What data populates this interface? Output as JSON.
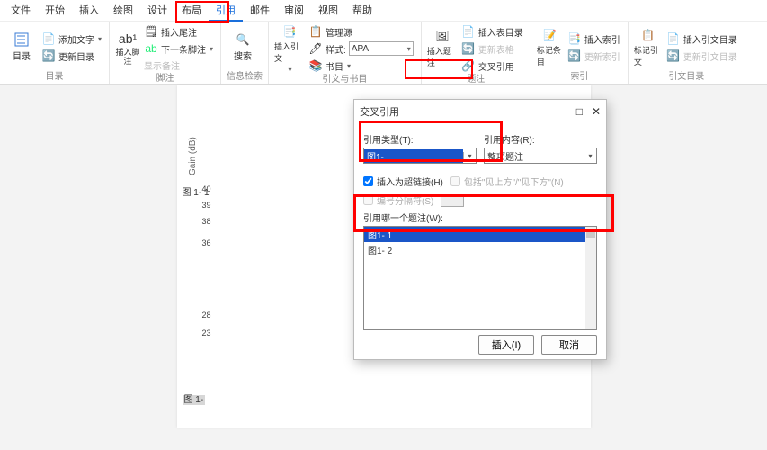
{
  "menu": {
    "items": [
      "文件",
      "开始",
      "插入",
      "绘图",
      "设计",
      "布局",
      "引用",
      "邮件",
      "审阅",
      "视图",
      "帮助"
    ],
    "active": 6
  },
  "ribbon": {
    "toc": {
      "big": "目录",
      "addText": "添加文字",
      "update": "更新目录",
      "label": "目录"
    },
    "footnote": {
      "big": "插入脚注",
      "next": "下一条脚注",
      "show": "显示备注",
      "label": "脚注"
    },
    "search": {
      "big": "搜索",
      "label": "信息检索"
    },
    "citation": {
      "big": "插入引文",
      "manage": "管理源",
      "styleLbl": "样式:",
      "styleVal": "APA",
      "bib": "书目",
      "label": "引文与书目"
    },
    "caption": {
      "big": "插入题注",
      "insTbl": "插入表目录",
      "cross": "交叉引用",
      "label": "题注"
    },
    "mark": {
      "big": "标记条目",
      "insIdx": "插入索引",
      "updIdx": "更新索引",
      "label": "索引"
    },
    "cite2": {
      "big": "标记引文",
      "insCit": "插入引文目录",
      "updCit": "更新引文目录",
      "label": "引文目录"
    }
  },
  "doc": {
    "axis": "Gain (dB)",
    "yticks": [
      "40",
      "39",
      "38",
      "36",
      "28",
      "23"
    ],
    "cap1pre": "图 1- 1",
    "cap2pre": "图 1-"
  },
  "dialog": {
    "title": "交叉引用",
    "typeLbl": "引用类型(T):",
    "typeVal": "图1-",
    "contentLbl": "引用内容(R):",
    "contentVal": "整项题注",
    "chk1": "",
    "chkHyper": "",
    "above": "包括\"见上方\"/\"见下方\"(N)",
    "sepLbl": "编号分隔符(S)",
    "listLbl": "引用哪一个题注(W):",
    "items": [
      "图1- 1",
      "图1- 2"
    ],
    "insert": "插入(I)",
    "cancel": "取消",
    "max": "□",
    "close": "✕"
  }
}
